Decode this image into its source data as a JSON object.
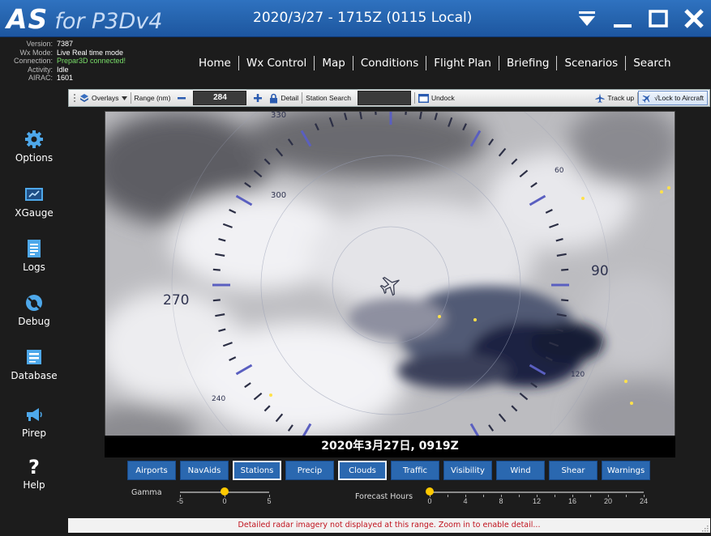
{
  "window": {
    "title_brand": "AS",
    "title_sub": "for P3Dv4",
    "title_datetime": "2020/3/27 - 1715Z (0115 Local)"
  },
  "info": [
    {
      "label": "Version:",
      "value": "7387"
    },
    {
      "label": "Wx Mode:",
      "value": "Live Real time mode"
    },
    {
      "label": "Connection:",
      "value": "Prepar3D connected!"
    },
    {
      "label": "Activity:",
      "value": "Idle"
    },
    {
      "label": "AIRAC:",
      "value": "1601"
    }
  ],
  "nav": [
    "Home",
    "Wx Control",
    "Map",
    "Conditions",
    "Flight Plan",
    "Briefing",
    "Scenarios",
    "Search"
  ],
  "toolbar": {
    "overlays": "Overlays",
    "range_label": "Range (nm)",
    "range_value": "284",
    "detail": "Detail",
    "station_search": "Station Search",
    "undock": "Undock",
    "track_up": "Track up",
    "lock_to_aircraft": "√Lock to Aircraft"
  },
  "sidebar": [
    "Options",
    "XGauge",
    "Logs",
    "Debug",
    "Database",
    "Pirep",
    "Help"
  ],
  "map": {
    "caption": "2020年3月27日, 0919Z",
    "compass_labels": {
      "n330": "330",
      "n300": "300",
      "n270": "270",
      "n240": "240",
      "n60": "60",
      "n90": "90",
      "n120": "120"
    }
  },
  "layers": [
    "Airports",
    "NavAids",
    "Stations",
    "Precip",
    "Clouds",
    "Traffic",
    "Visibility",
    "Wind",
    "Shear",
    "Warnings"
  ],
  "gamma": {
    "label": "Gamma",
    "ticks": [
      "-5",
      "0",
      "5"
    ],
    "value": 0
  },
  "forecast": {
    "label": "Forecast Hours",
    "ticks": [
      "0",
      "4",
      "8",
      "12",
      "16",
      "20",
      "24"
    ],
    "value": 0
  },
  "status": "Detailed radar imagery not displayed at this range. Zoom in to enable detail...",
  "colors": {
    "titlebar": "#2563ad",
    "layer_button": "#2a68b0",
    "status_text": "#c0121d",
    "connected": "#7adf6a"
  }
}
